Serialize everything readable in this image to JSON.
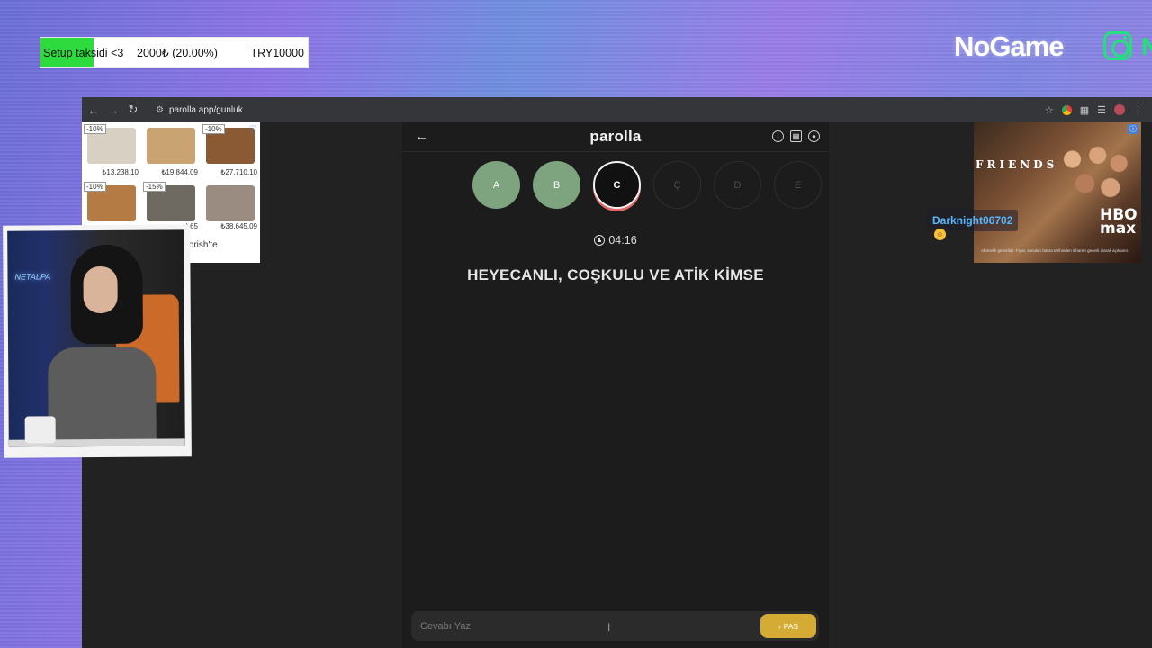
{
  "goal": {
    "title": "Setup taksidi <3",
    "current": "2000₺ (20.00%)",
    "target": "TRY10000",
    "progress_percent": 20.0,
    "fill_color": "#2edb3f"
  },
  "branding": {
    "name": "NoGame",
    "social_icon": "instagram-icon",
    "trailing_text": "N"
  },
  "browser": {
    "back_icon": "arrow-left-icon",
    "forward_icon": "arrow-right-icon",
    "reload_icon": "reload-icon",
    "url": "parolla.app/gunluk",
    "extensions": [
      "star-icon",
      "color-extension-icon",
      "puzzle-icon",
      "media-icon",
      "profile-avatar",
      "kebab-menu-icon"
    ]
  },
  "ad_left": {
    "products": [
      {
        "badge": "-10%",
        "price": "₺13.238,10"
      },
      {
        "badge": "",
        "price": "₺19.844,09"
      },
      {
        "badge": "-10%",
        "price": "₺27.710,10"
      },
      {
        "badge": "-10%",
        "price": ""
      },
      {
        "badge": "-15%",
        "price": "₺65"
      },
      {
        "badge": "",
        "price": "₺38.645,09"
      }
    ],
    "footer": "torish'te"
  },
  "ad_right": {
    "show": "FRIENDS",
    "network": "HBO max",
    "fine_print": "Abonelik gereklidir. Fiyat, sunulan fatura tarihinden itibaren geçerli olarak açıklanır."
  },
  "game": {
    "title": "parolla",
    "back_icon": "arrow-left-icon",
    "header_icons": [
      "info-icon",
      "stats-icon",
      "account-icon"
    ],
    "letters": [
      {
        "label": "A",
        "state": "done"
      },
      {
        "label": "B",
        "state": "done"
      },
      {
        "label": "C",
        "state": "active"
      },
      {
        "label": "Ç",
        "state": "pending"
      },
      {
        "label": "D",
        "state": "pending"
      },
      {
        "label": "E",
        "state": "pending"
      }
    ],
    "timer": "04:16",
    "question": "HEYECANLI, COŞKULU VE ATİK KİMSE",
    "answer_placeholder": "Cevabı Yaz",
    "pass_label": "PAS",
    "accent_color": "#d4ac35",
    "done_color": "#7ea37f"
  },
  "webcam": {
    "neon_text": "NETALPA"
  },
  "chat": {
    "username": "Darknight06702"
  }
}
